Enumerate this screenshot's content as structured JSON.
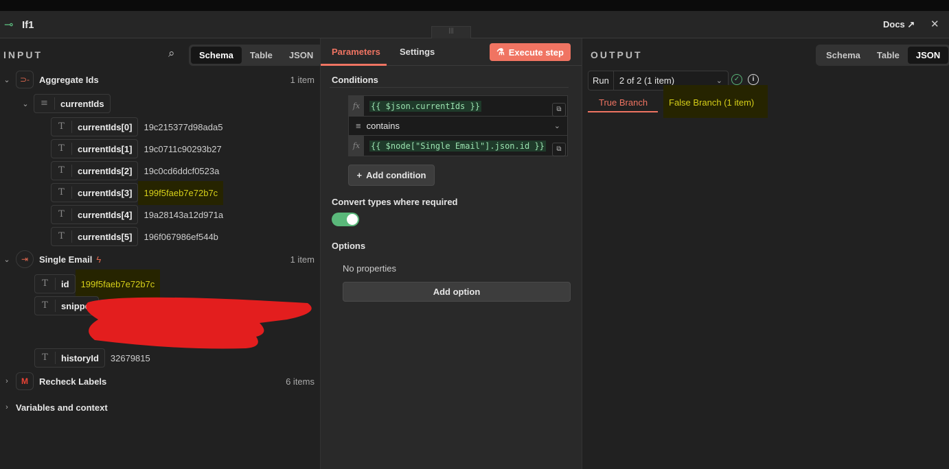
{
  "header": {
    "title": "If1",
    "docs": "Docs"
  },
  "input": {
    "label": "INPUT",
    "views": [
      "Schema",
      "Table",
      "JSON"
    ],
    "nodes": [
      {
        "name": "Aggregate Ids",
        "count": "1 item"
      },
      {
        "name": "Single Email",
        "count": "1 item"
      },
      {
        "name": "Recheck Labels",
        "count": "6 items"
      }
    ],
    "array_key": "currentIds",
    "items": [
      {
        "key": "currentIds[0]",
        "value": "19c215377d98ada5"
      },
      {
        "key": "currentIds[1]",
        "value": "19c0711c90293b27"
      },
      {
        "key": "currentIds[2]",
        "value": "19c0cd6ddcf0523a"
      },
      {
        "key": "currentIds[3]",
        "value": "199f5faeb7e72b7c"
      },
      {
        "key": "currentIds[4]",
        "value": "19a28143a12d971a"
      },
      {
        "key": "currentIds[5]",
        "value": "196f067986ef544b"
      }
    ],
    "email_fields": [
      {
        "key": "id",
        "value": "199f5faeb7e72b7c"
      },
      {
        "key": "snippet",
        "value": ""
      },
      {
        "key": "historyId",
        "value": "32679815"
      }
    ],
    "variables": "Variables and context"
  },
  "params": {
    "tabs": [
      "Parameters",
      "Settings"
    ],
    "execute": "Execute step",
    "conditions_title": "Conditions",
    "left_value": "{{ $json.currentIds }}",
    "operator": "contains",
    "right_value": "{{ $node[\"Single Email\"].json.id }}",
    "add_condition": "Add condition",
    "convert_label": "Convert types where required",
    "convert_on": true,
    "options_title": "Options",
    "no_props": "No properties",
    "add_option": "Add option"
  },
  "output": {
    "label": "OUTPUT",
    "views": [
      "Schema",
      "Table",
      "JSON"
    ],
    "run_label": "Run",
    "run_value": "2 of 2 (1 item)",
    "branches": [
      "True Branch",
      "False Branch (1 item)"
    ]
  },
  "colors": {
    "accent": "#f07462",
    "highlight": "#d6cf19"
  }
}
